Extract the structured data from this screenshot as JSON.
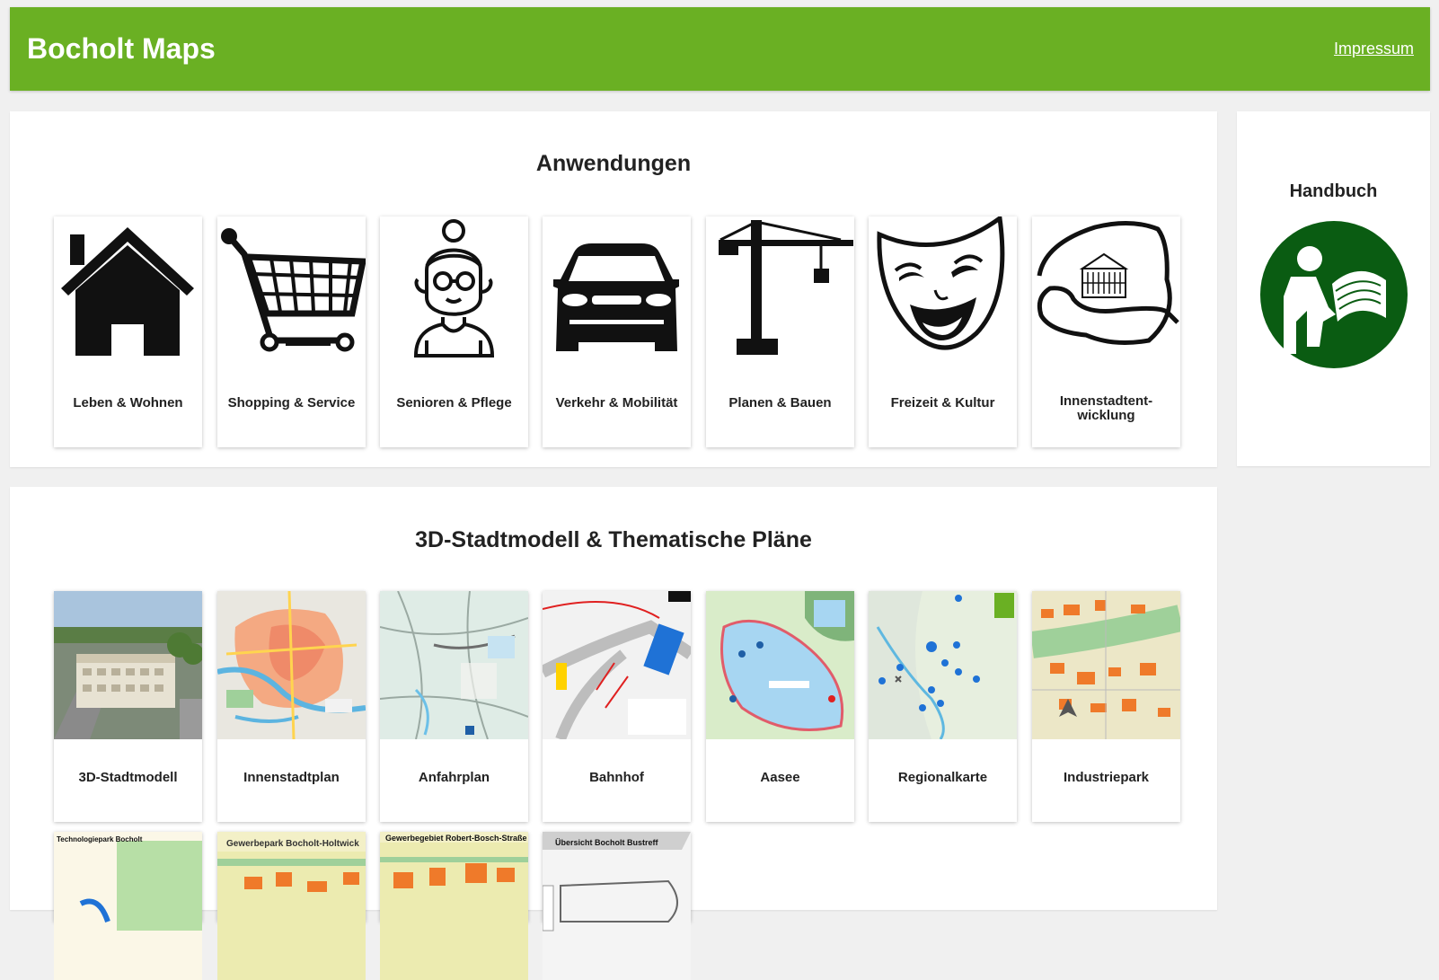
{
  "header": {
    "title": "Bocholt Maps",
    "impressum": "Impressum"
  },
  "applications": {
    "title": "Anwendungen",
    "items": [
      {
        "label": "Leben & Wohnen",
        "icon": "house-icon"
      },
      {
        "label": "Shopping & Service",
        "icon": "shopping-cart-icon"
      },
      {
        "label": "Senioren & Pflege",
        "icon": "senior-person-icon"
      },
      {
        "label": "Verkehr & Mobilität",
        "icon": "car-icon"
      },
      {
        "label": "Planen & Bauen",
        "icon": "crane-icon"
      },
      {
        "label": "Freizeit & Kultur",
        "icon": "theater-mask-icon"
      },
      {
        "label": "Innenstadtent-\nwicklung",
        "icon": "city-center-icon"
      }
    ]
  },
  "handbook": {
    "title": "Handbuch",
    "icon": "manual-reader-icon"
  },
  "maps": {
    "title": "3D-Stadtmodell & Thematische Pläne",
    "items": [
      {
        "label": "3D-Stadtmodell"
      },
      {
        "label": "Innenstadtplan"
      },
      {
        "label": "Anfahrplan"
      },
      {
        "label": "Bahnhof"
      },
      {
        "label": "Aasee"
      },
      {
        "label": "Regionalkarte"
      },
      {
        "label": "Industriepark"
      }
    ],
    "partial_items": [
      {
        "heading": "Technologiepark Bocholt"
      },
      {
        "heading": "Gewerbepark Bocholt-Holtwick"
      },
      {
        "heading": "Gewerbegebiet Robert-Bosch-Straße"
      },
      {
        "heading": "Übersicht Bocholt Bustreff"
      }
    ]
  },
  "colors": {
    "header": "#6ab023",
    "handbook_circle": "#0a5c12",
    "background": "#f0f0f0"
  }
}
